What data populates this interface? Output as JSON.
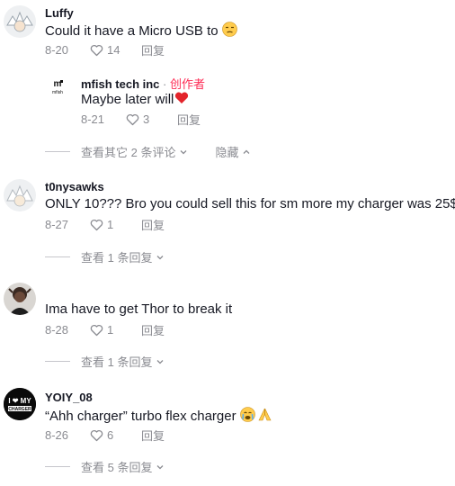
{
  "comments": [
    {
      "username": "Luffy",
      "text": "Could it have a Micro USB to",
      "date": "8-20",
      "likes": "14",
      "reply_label": "回复",
      "emoji": "unamused-face-icon"
    },
    {
      "username": "mfish tech inc",
      "author_sep": " · ",
      "author_tag": "创作者",
      "text": "Maybe later will",
      "date": "8-21",
      "likes": "3",
      "reply_label": "回复",
      "emoji": "red-heart-icon"
    },
    {
      "username": "t0nysawks",
      "text": "ONLY 10??? Bro you could sell this for sm more my charger was 25$",
      "date": "8-27",
      "likes": "1",
      "reply_label": "回复"
    },
    {
      "username": "",
      "text": "Ima have to get Thor to break it",
      "date": "8-28",
      "likes": "1",
      "reply_label": "回复"
    },
    {
      "username": "YOIY_08",
      "text": "“Ahh charger” turbo flex charger",
      "date": "8-26",
      "likes": "6",
      "reply_label": "回复",
      "emoji": "crying-face-and-praying-hands-icon",
      "avatar_text_top": "I ❤ MY",
      "avatar_text_bottom": "CHARGER"
    }
  ],
  "threads": [
    {
      "label": "查看其它 2 条评论",
      "hide_label": "隐藏"
    },
    {
      "label": "查看 1 条回复"
    },
    {
      "label": "查看 1 条回复"
    },
    {
      "label": "查看 5 条回复"
    }
  ],
  "reply_avatar": {
    "logo_text": "mfish"
  },
  "colors": {
    "author_tag": "#fe2c55",
    "secondary_text": "#8a8b91",
    "heart": "#e3242b"
  }
}
